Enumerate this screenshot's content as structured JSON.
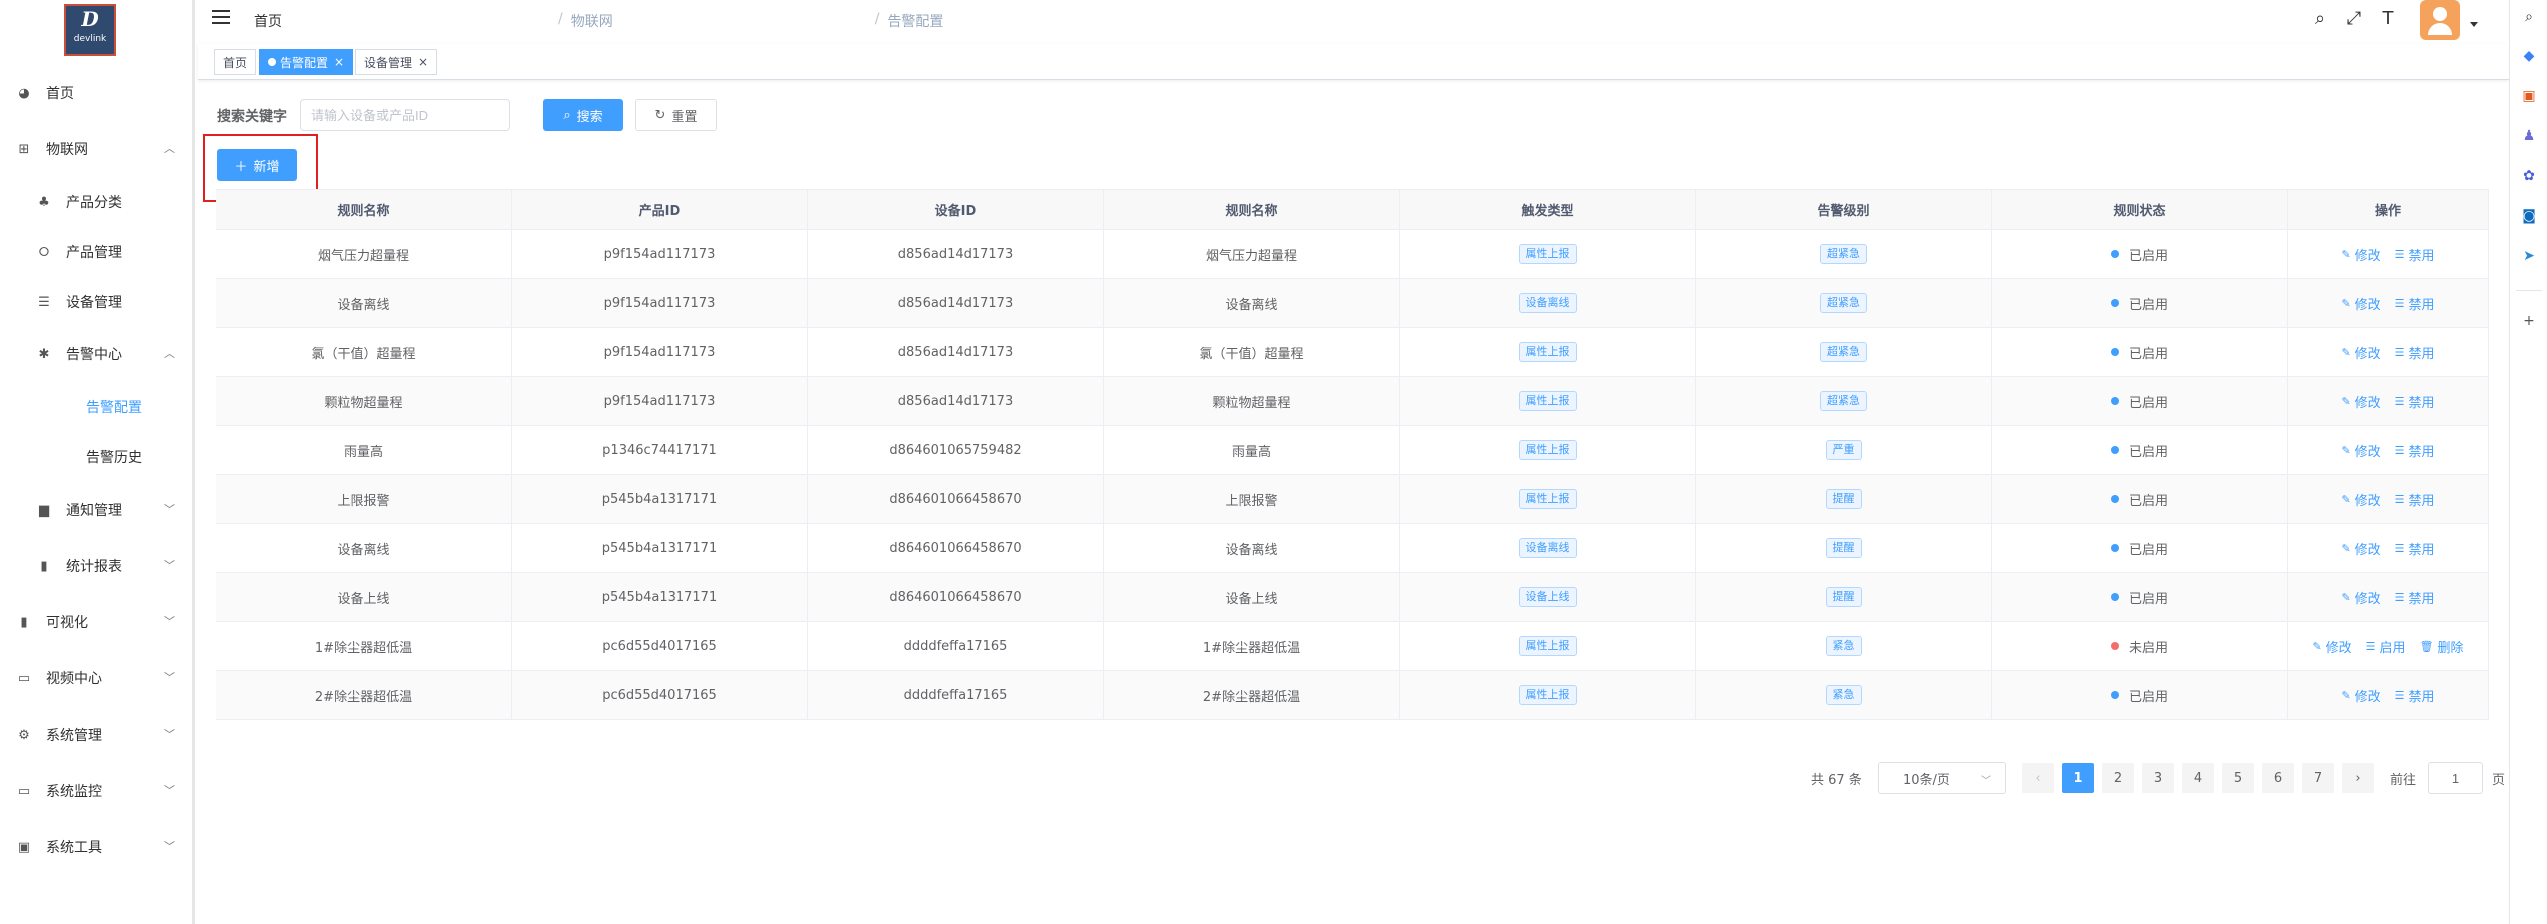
{
  "app": {
    "logo_letter": "D",
    "logo_text": "devlink"
  },
  "sidebar": {
    "items": [
      {
        "label": "首页",
        "icon": "dashboard-icon"
      },
      {
        "label": "物联网",
        "icon": "grid-icon"
      },
      {
        "label": "产品分类",
        "icon": "hierarchy-icon"
      },
      {
        "label": "产品管理",
        "icon": "circle-gear-icon"
      },
      {
        "label": "设备管理",
        "icon": "sliders-icon"
      },
      {
        "label": "告警中心",
        "icon": "bug-icon"
      },
      {
        "label": "告警配置"
      },
      {
        "label": "告警历史"
      },
      {
        "label": "通知管理",
        "icon": "message-icon"
      },
      {
        "label": "统计报表",
        "icon": "bar-chart-icon"
      },
      {
        "label": "可视化",
        "icon": "bar-chart-icon"
      },
      {
        "label": "视频中心",
        "icon": "monitor-icon"
      },
      {
        "label": "系统管理",
        "icon": "gear-icon"
      },
      {
        "label": "系统监控",
        "icon": "monitor-icon"
      },
      {
        "label": "系统工具",
        "icon": "toolbox-icon"
      }
    ]
  },
  "header": {
    "breadcrumb": [
      "首页",
      "物联网",
      "告警配置"
    ],
    "breadcrumb_sep": "/"
  },
  "tags": [
    {
      "label": "首页"
    },
    {
      "label": "告警配置",
      "active": true
    },
    {
      "label": "设备管理"
    }
  ],
  "search": {
    "label": "搜索关键字",
    "placeholder": "请输入设备或产品ID",
    "search_button": "搜索",
    "reset_button": "重置",
    "add_button": "新增"
  },
  "table": {
    "columns": [
      "规则名称",
      "产品ID",
      "设备ID",
      "规则名称",
      "触发类型",
      "告警级别",
      "规则状态",
      "操作"
    ],
    "rows": [
      [
        "烟气压力超量程",
        "p9f154ad117173",
        "d856ad14d17173",
        "烟气压力超量程",
        "属性上报",
        "超紧急",
        "已启用"
      ],
      [
        "设备离线",
        "p9f154ad117173",
        "d856ad14d17173",
        "设备离线",
        "设备离线",
        "超紧急",
        "已启用"
      ],
      [
        "氯（干值）超量程",
        "p9f154ad117173",
        "d856ad14d17173",
        "氯（干值）超量程",
        "属性上报",
        "超紧急",
        "已启用"
      ],
      [
        "颗粒物超量程",
        "p9f154ad117173",
        "d856ad14d17173",
        "颗粒物超量程",
        "属性上报",
        "超紧急",
        "已启用"
      ],
      [
        "雨量高",
        "p1346c74417171",
        "d864601065759482",
        "雨量高",
        "属性上报",
        "严重",
        "已启用"
      ],
      [
        "上限报警",
        "p545b4a1317171",
        "d864601066458670",
        "上限报警",
        "属性上报",
        "提醒",
        "已启用"
      ],
      [
        "设备离线",
        "p545b4a1317171",
        "d864601066458670",
        "设备离线",
        "设备离线",
        "提醒",
        "已启用"
      ],
      [
        "设备上线",
        "p545b4a1317171",
        "d864601066458670",
        "设备上线",
        "设备上线",
        "提醒",
        "已启用"
      ],
      [
        "1#除尘器超低温",
        "pc6d55d4017165",
        "ddddfeffa17165",
        "1#除尘器超低温",
        "属性上报",
        "紧急",
        "未启用"
      ],
      [
        "2#除尘器超低温",
        "pc6d55d4017165",
        "ddddfeffa17165",
        "2#除尘器超低温",
        "属性上报",
        "紧急",
        "已启用"
      ]
    ],
    "ops_enabled": [
      "修改",
      "禁用"
    ],
    "ops_disabled": [
      "修改",
      "启用",
      "删除"
    ]
  },
  "pagination": {
    "total_text": "共 67 条",
    "page_size": "10条/页",
    "pages": [
      "1",
      "2",
      "3",
      "4",
      "5",
      "6",
      "7"
    ],
    "current": 1,
    "goto_label": "前往",
    "goto_value": "1",
    "goto_suffix": "页",
    "prev": "‹",
    "next": "›"
  },
  "colors": {
    "primary": "#409eff",
    "danger": "#f56c6c",
    "highlight": "#e02020"
  }
}
